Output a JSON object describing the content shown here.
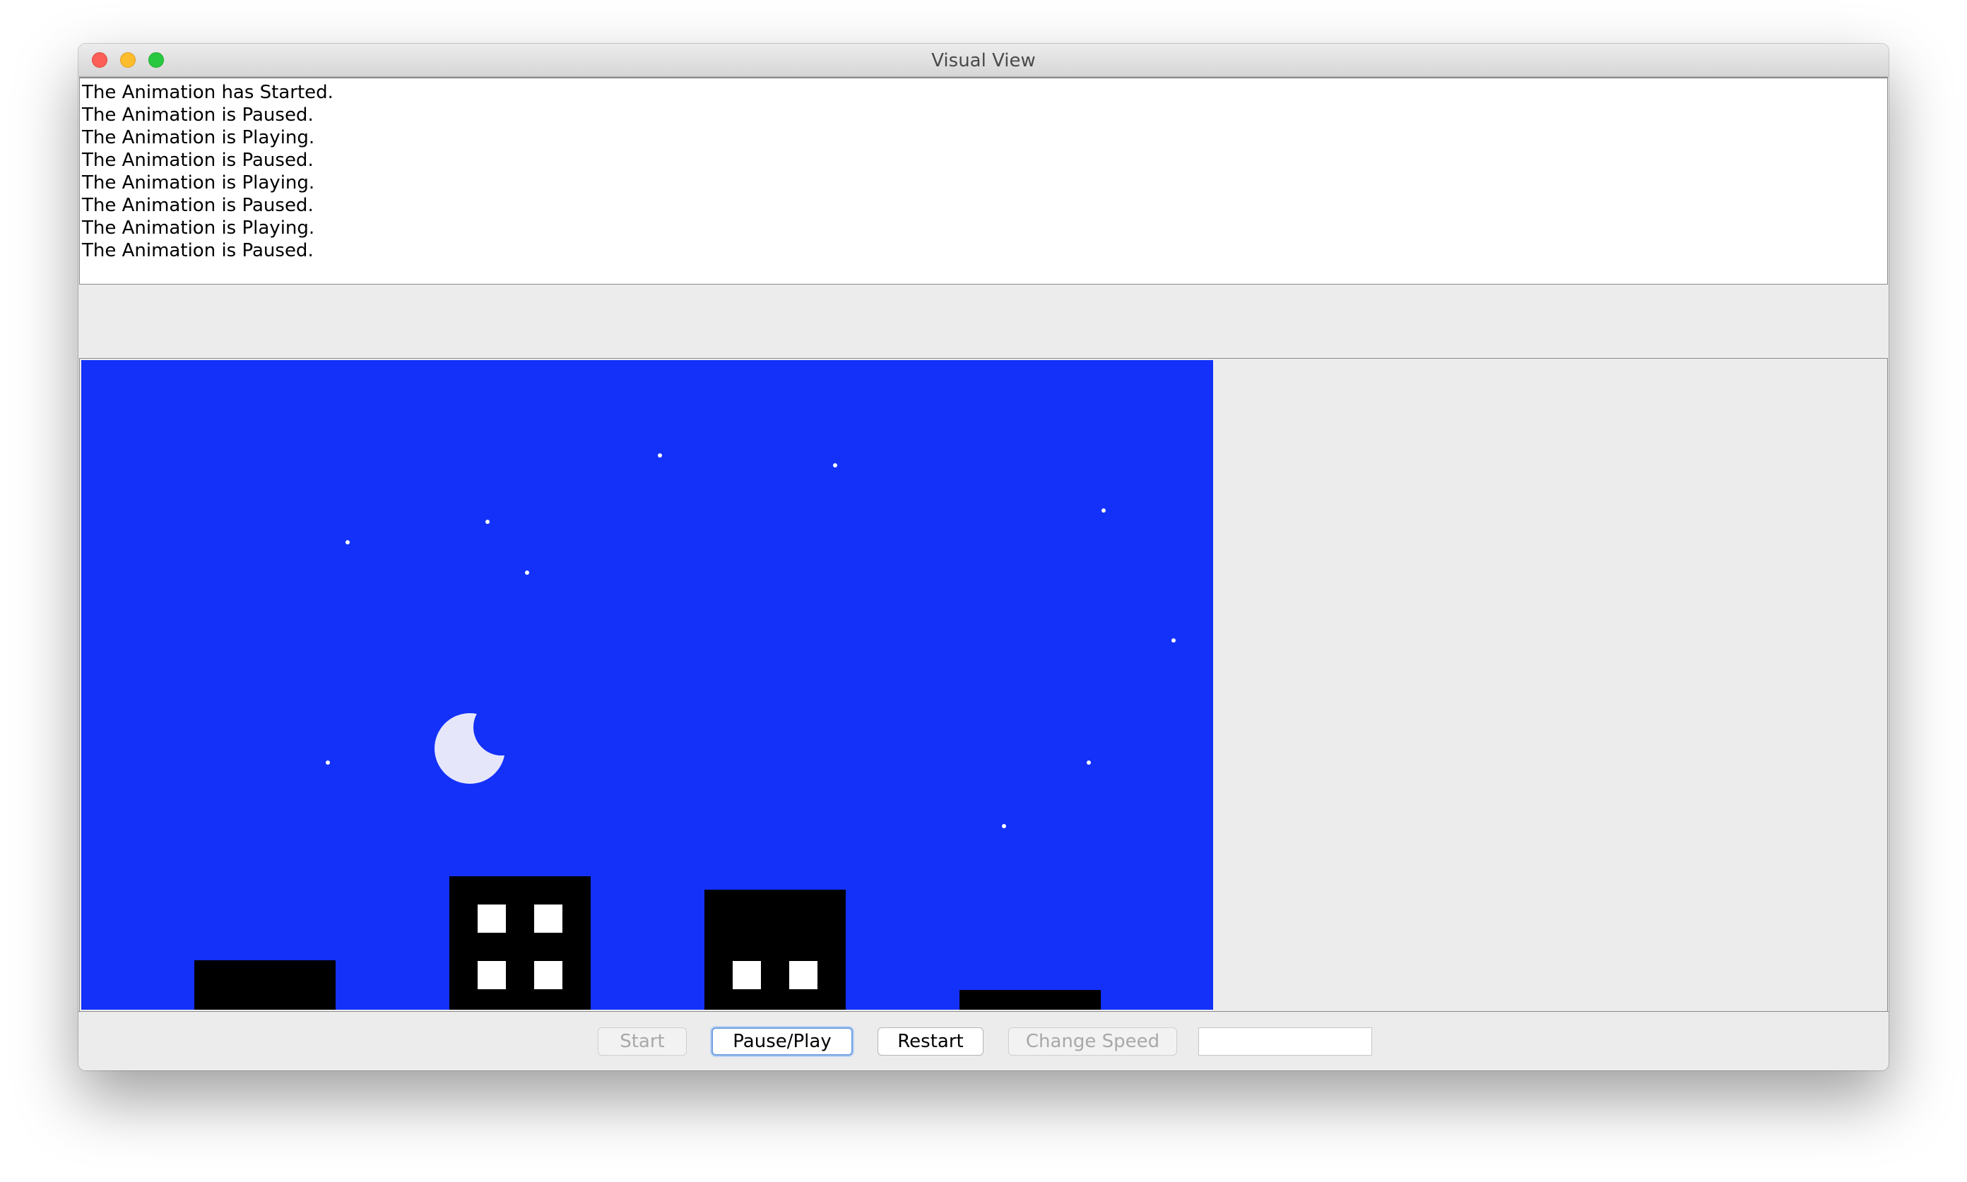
{
  "window": {
    "title": "Visual View"
  },
  "log": {
    "lines": [
      "The Animation has Started.",
      "The Animation is Paused.",
      "The Animation is Playing.",
      "The Animation is Paused.",
      "The Animation is Playing.",
      "The Animation is Paused.",
      "The Animation is Playing.",
      "The Animation is Paused."
    ]
  },
  "scene": {
    "sky_color": "#1431fa",
    "moon_color": "#e6e6fa",
    "building_color": "#000000",
    "window_color": "#ffffff",
    "star_color": "#ffffff"
  },
  "controls": {
    "start_label": "Start",
    "pause_play_label": "Pause/Play",
    "restart_label": "Restart",
    "change_speed_label": "Change Speed",
    "speed_value": "",
    "speed_placeholder": ""
  }
}
